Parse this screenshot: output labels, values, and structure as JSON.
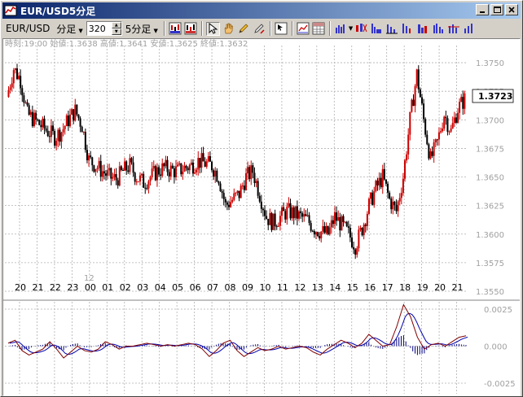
{
  "window": {
    "title": "EUR/USD5分足"
  },
  "toolbar": {
    "symbol": "EUR/USD",
    "period": "分足",
    "bar_count": "320",
    "timeframe": "5分足"
  },
  "info_line": "時刻:19:00 始値:1.3638 高値:1.3641 安値:1.3625 終値:1.3632",
  "price_axis": {
    "ticks": [
      "1.3750",
      "1.3725",
      "1.3700",
      "1.3675",
      "1.3650",
      "1.3625",
      "1.3600",
      "1.3575",
      "1.3550"
    ],
    "current_price": "1.3723"
  },
  "time_axis": {
    "ticks": [
      "20",
      "21",
      "22",
      "23",
      "00",
      "01",
      "02",
      "03",
      "04",
      "05",
      "06",
      "07",
      "08",
      "09",
      "10",
      "11",
      "12",
      "13",
      "14",
      "15",
      "16",
      "17",
      "18",
      "19",
      "20",
      "21"
    ],
    "day_marker": "12"
  },
  "oscillator_axis": {
    "ticks": [
      "0.0025",
      "0.000",
      "-0.0025"
    ]
  },
  "colors": {
    "up_candle": "#cc0000",
    "down_candle": "#000000",
    "macd_line": "#800000",
    "signal_line": "#0000aa",
    "histogram": "#000080",
    "grid": "#b0b0b0"
  },
  "chart_data": {
    "type": "candlestick",
    "y_range": [
      1.355,
      1.3765
    ],
    "close_path": [
      [
        0,
        1.372
      ],
      [
        1,
        1.3745
      ],
      [
        2,
        1.3735
      ],
      [
        3,
        1.3705
      ],
      [
        4,
        1.37
      ],
      [
        5,
        1.3695
      ],
      [
        6,
        1.369
      ],
      [
        7,
        1.3685
      ],
      [
        8,
        1.369
      ],
      [
        9,
        1.37
      ],
      [
        10,
        1.3708
      ],
      [
        11,
        1.3695
      ],
      [
        12,
        1.3665
      ],
      [
        13,
        1.366
      ],
      [
        14,
        1.3655
      ],
      [
        15,
        1.365
      ],
      [
        16,
        1.3648
      ],
      [
        17,
        1.3655
      ],
      [
        18,
        1.366
      ],
      [
        19,
        1.365
      ],
      [
        20,
        1.3645
      ],
      [
        21,
        1.365
      ],
      [
        22,
        1.3655
      ],
      [
        23,
        1.3658
      ],
      [
        24,
        1.3656
      ],
      [
        25,
        1.3655
      ],
      [
        26,
        1.3658
      ],
      [
        27,
        1.366
      ],
      [
        28,
        1.3664
      ],
      [
        29,
        1.3662
      ],
      [
        30,
        1.366
      ],
      [
        31,
        1.365
      ],
      [
        32,
        1.3625
      ],
      [
        33,
        1.363
      ],
      [
        34,
        1.3635
      ],
      [
        35,
        1.365
      ],
      [
        36,
        1.3655
      ],
      [
        37,
        1.3635
      ],
      [
        38,
        1.3615
      ],
      [
        39,
        1.361
      ],
      [
        40,
        1.3615
      ],
      [
        41,
        1.362
      ],
      [
        42,
        1.3618
      ],
      [
        43,
        1.3615
      ],
      [
        44,
        1.3612
      ],
      [
        45,
        1.3605
      ],
      [
        46,
        1.3602
      ],
      [
        47,
        1.36
      ],
      [
        48,
        1.3615
      ],
      [
        49,
        1.3608
      ],
      [
        50,
        1.36
      ],
      [
        51,
        1.359
      ],
      [
        52,
        1.3605
      ],
      [
        53,
        1.3625
      ],
      [
        54,
        1.364
      ],
      [
        55,
        1.365
      ],
      [
        56,
        1.363
      ],
      [
        57,
        1.362
      ],
      [
        58,
        1.365
      ],
      [
        59,
        1.37
      ],
      [
        60,
        1.374
      ],
      [
        61,
        1.37
      ],
      [
        62,
        1.3665
      ],
      [
        63,
        1.368
      ],
      [
        64,
        1.3705
      ],
      [
        65,
        1.369
      ],
      [
        66,
        1.371
      ],
      [
        67,
        1.3718
      ]
    ],
    "macd_path": [
      [
        0,
        0.0002
      ],
      [
        1,
        0.0004
      ],
      [
        2,
        -0.0003
      ],
      [
        3,
        -0.0006
      ],
      [
        4,
        -0.0004
      ],
      [
        5,
        -0.0002
      ],
      [
        6,
        0.0003
      ],
      [
        7,
        -0.0002
      ],
      [
        8,
        -0.0008
      ],
      [
        9,
        -0.0004
      ],
      [
        10,
        0.0
      ],
      [
        11,
        -0.0003
      ],
      [
        12,
        -0.0004
      ],
      [
        13,
        -0.0002
      ],
      [
        14,
        0.0003
      ],
      [
        15,
        0.0001
      ],
      [
        16,
        -0.0002
      ],
      [
        17,
        0.0
      ],
      [
        18,
        0.0
      ],
      [
        19,
        0.0001
      ],
      [
        20,
        0.0002
      ],
      [
        21,
        0.0001
      ],
      [
        22,
        0.0
      ],
      [
        23,
        0.0001
      ],
      [
        24,
        0.0
      ],
      [
        25,
        0.0001
      ],
      [
        26,
        0.0002
      ],
      [
        27,
        0.0001
      ],
      [
        28,
        -0.0002
      ],
      [
        29,
        -0.0007
      ],
      [
        30,
        -0.0003
      ],
      [
        31,
        0.0002
      ],
      [
        32,
        0.0004
      ],
      [
        33,
        -0.0003
      ],
      [
        34,
        -0.0007
      ],
      [
        35,
        -0.0004
      ],
      [
        36,
        -0.0001
      ],
      [
        37,
        -0.0003
      ],
      [
        38,
        -0.0002
      ],
      [
        39,
        0.0
      ],
      [
        40,
        -0.0002
      ],
      [
        41,
        -0.0001
      ],
      [
        42,
        0.0
      ],
      [
        43,
        -0.0001
      ],
      [
        44,
        -0.0004
      ],
      [
        45,
        -0.0006
      ],
      [
        46,
        -0.0002
      ],
      [
        47,
        0.0001
      ],
      [
        48,
        0.0004
      ],
      [
        49,
        0.0002
      ],
      [
        50,
        -0.0001
      ],
      [
        51,
        0.0002
      ],
      [
        52,
        0.0008
      ],
      [
        53,
        0.0004
      ],
      [
        54,
        0.0
      ],
      [
        55,
        0.0001
      ],
      [
        56,
        0.0013
      ],
      [
        57,
        0.0028
      ],
      [
        58,
        0.002
      ],
      [
        59,
        0.0006
      ],
      [
        60,
        -0.0002
      ],
      [
        61,
        0.0001
      ],
      [
        62,
        0.0002
      ],
      [
        63,
        0.0
      ],
      [
        64,
        0.0003
      ],
      [
        65,
        0.0006
      ],
      [
        66,
        0.0007
      ]
    ]
  }
}
